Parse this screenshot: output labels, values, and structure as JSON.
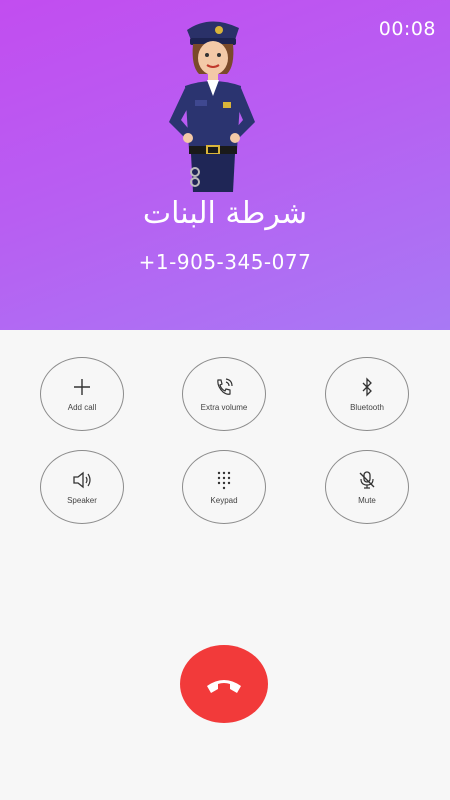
{
  "call": {
    "timer": "00:08",
    "caller_name": "شرطة البنات",
    "caller_number": "+1-905-345-077"
  },
  "controls": [
    {
      "label": "Add call",
      "icon": "plus-icon"
    },
    {
      "label": "Extra volume",
      "icon": "phone-volume-icon"
    },
    {
      "label": "Bluetooth",
      "icon": "bluetooth-icon"
    },
    {
      "label": "Speaker",
      "icon": "speaker-icon"
    },
    {
      "label": "Keypad",
      "icon": "keypad-icon"
    },
    {
      "label": "Mute",
      "icon": "mic-off-icon"
    }
  ],
  "end_call": {
    "icon": "hang-up-icon",
    "color": "#f23a3a"
  },
  "colors": {
    "header_top": "#c24df0",
    "header_bottom": "#a879f4",
    "background": "#f7f7f7"
  }
}
